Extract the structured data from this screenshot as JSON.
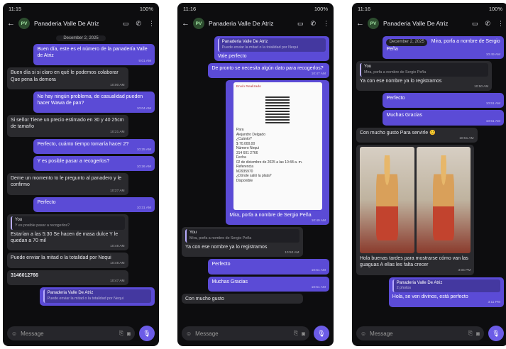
{
  "phone1": {
    "status_time": "11:15",
    "status_right": "100%",
    "contact": "Panaderia Valle De Atriz",
    "avatar": "PV",
    "date_chip": "December 2, 2025",
    "messages": [
      {
        "dir": "out",
        "text": "Buen día, este es el número de la panadería Valle de Atriz",
        "time": "9:01 AM"
      },
      {
        "dir": "in",
        "text": "Buen día si si claro en qué le podemos colaborar Que pena la demora",
        "time": "10:00 AM"
      },
      {
        "dir": "out",
        "text": "No hay ningún problema, de casualidad pueden hacer Wawa de pan?",
        "time": "10:04 AM"
      },
      {
        "dir": "in",
        "text": "Si señor Tiene un precio estimado en 30 y 40 25cm de tamaño",
        "time": "10:21 AM"
      },
      {
        "dir": "out",
        "text": "Perfecto, cuánto tiempo tomaría hacer 2?",
        "time": "10:25 AM"
      },
      {
        "dir": "out",
        "text": "Y es posible pasar a recogerlos?",
        "time": "10:26 AM"
      },
      {
        "dir": "in",
        "text": "Deme un momento to le pregunto al panadero y le confirmo",
        "time": "10:27 AM"
      },
      {
        "dir": "out",
        "text": "Perfecto",
        "time": "10:31 AM"
      }
    ],
    "quote_msg": {
      "quote_author": "You",
      "quote_text": "Y es posible pasar a recogerlos?",
      "text": "Estarían a las 5:30 Se hacen de masa dulce Y le quedan a 70 mil",
      "time": "10:46 AM"
    },
    "msg_after": {
      "text": "Puede enviar la mitad o la totalidad por Nequi",
      "time": "10:46 AM"
    },
    "number_msg": {
      "text": "3146012766",
      "time": "10:47 AM"
    },
    "preview": {
      "author": "Panaderia Valle De Atriz",
      "text": "Puede enviar la mitad o la totalidad por Nequi"
    },
    "input_placeholder": "Message"
  },
  "phone2": {
    "status_time": "11:16",
    "status_right": "100%",
    "contact": "Panaderia Valle De Atriz",
    "avatar": "PV",
    "top_quote": {
      "author": "Panaderia Valle De Atriz",
      "text": "Puede enviar la mitad o la totalidad por Nequi",
      "msg": "Vale perfecto",
      "time": ""
    },
    "msg1": {
      "text": "De pronto se necesita algún dato para recogerlos?",
      "time": "10:47 AM"
    },
    "receipt": {
      "header": "Envío Realizado",
      "lines": [
        "Para",
        "Alejandro Delgado",
        "¿Cuánto?",
        "$ 70.000,00",
        "Número Nequi",
        "314 601 2766",
        "Fecha",
        "02 de diciembre de 2025 a las 10:48 a. m.",
        "Referencia",
        "M2935970",
        "¿Dónde salió la plata?",
        "Disponible"
      ]
    },
    "receipt_caption": {
      "text": "Mira, porfa a nombre de Sergio Peña",
      "time": "10:49 AM"
    },
    "quote_msg": {
      "quote_author": "You",
      "quote_text": "Mira, porfa a nombre de Sergio Peña",
      "text": "Ya con ese nombre ya lo registramos",
      "time": "10:50 AM"
    },
    "out1": {
      "text": "Perfecto",
      "time": "10:51 AM"
    },
    "out2": {
      "text": "Muchas Gracias",
      "time": "10:51 AM"
    },
    "last": {
      "text": "Con mucho gusto"
    },
    "input_placeholder": "Message"
  },
  "phone3": {
    "status_time": "11:16",
    "status_right": "100%",
    "contact": "Panaderia Valle De Atriz",
    "avatar": "PV",
    "top": {
      "text": "Mira, porfa a nombre de Sergio Peña",
      "time": "10:49 AM",
      "date_chip": "December 2, 2025"
    },
    "quote_msg": {
      "quote_author": "You",
      "quote_text": "Mira, porfa a nombre de Sergio Peña",
      "text": "Ya con ese nombre ya lo registramos",
      "time": "10:50 AM"
    },
    "out1": {
      "text": "Perfecto",
      "time": "10:51 AM"
    },
    "out2": {
      "text": "Muchas Gracias",
      "time": "10:51 AM"
    },
    "in1": {
      "text": "Con mucho gusto Para servirle",
      "emoji": "😊",
      "time": "10:51 AM"
    },
    "photo_caption": {
      "text": "Hola buenas tardes para mostrarse cómo van las guaguas A ellas les falta crecer",
      "time": "3:04 PM"
    },
    "reply": {
      "author": "Panaderia Valle De Atriz",
      "quote_text": "2 photos",
      "text": "Hola, se ven divinos, está perfecto",
      "time": "3:11 PM"
    },
    "input_placeholder": "Message"
  }
}
